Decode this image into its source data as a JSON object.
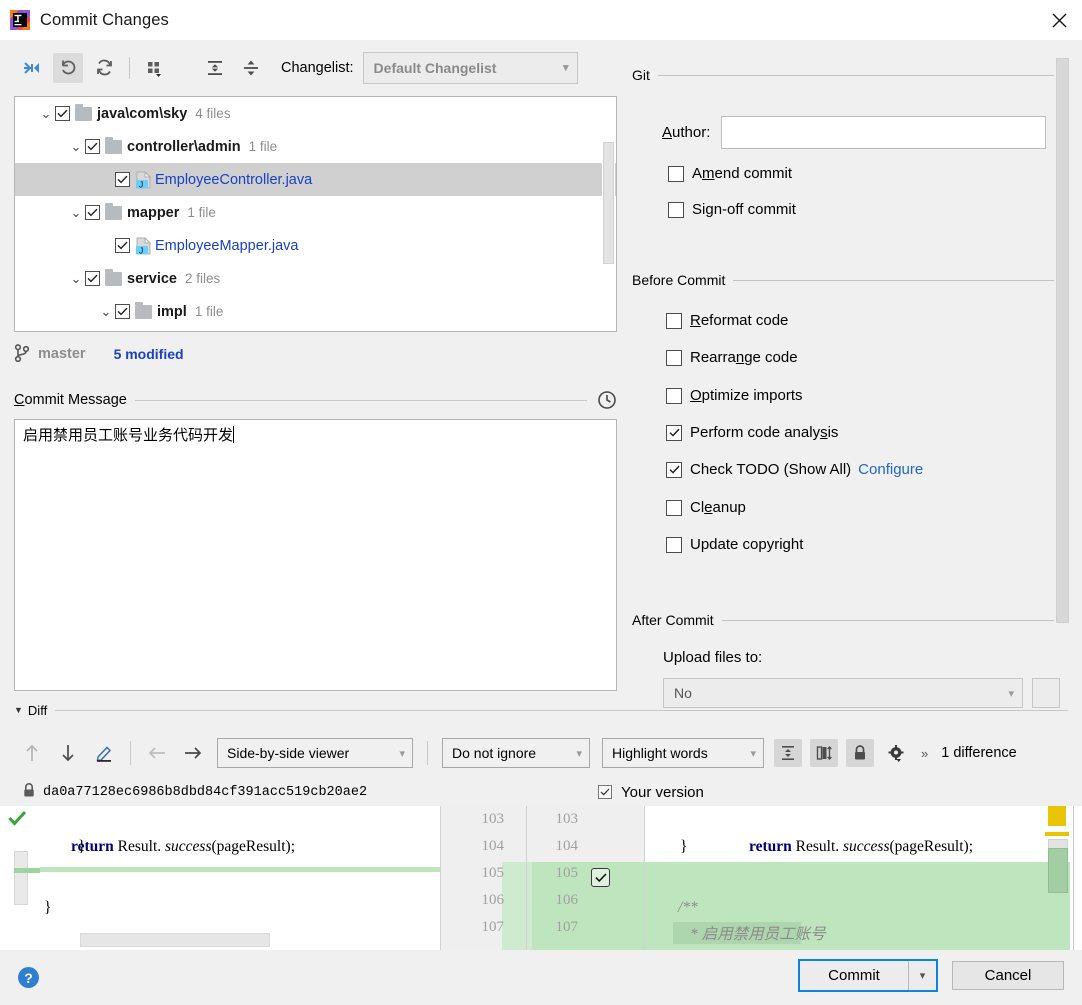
{
  "window": {
    "title": "Commit Changes",
    "logo_icon": "intellij-idea-logo",
    "close_icon": "close-icon"
  },
  "toolbar": {
    "icons": [
      {
        "name": "show-diff-icon",
        "glyph": "arrows-collapse"
      },
      {
        "name": "revert-icon",
        "glyph": "undo-arrow"
      },
      {
        "name": "refresh-icon",
        "glyph": "refresh-arrows"
      },
      {
        "name": "group-by-icon",
        "glyph": "grid-dropdown"
      },
      {
        "name": "expand-all-icon",
        "glyph": "expand"
      },
      {
        "name": "collapse-all-icon",
        "glyph": "collapse"
      }
    ],
    "changelist_label": "Changelist:",
    "changelist_value": "Default Changelist",
    "changelist_chevron": "chevron-down-icon"
  },
  "file_tree": {
    "rows": [
      {
        "indent": 0,
        "twisty": "⌄",
        "checked": true,
        "type": "folder",
        "name": "java\\com\\sky",
        "count": "4 files",
        "selected": false
      },
      {
        "indent": 1,
        "twisty": "⌄",
        "checked": true,
        "type": "folder",
        "name": "controller\\admin",
        "count": "1 file",
        "selected": false
      },
      {
        "indent": 2,
        "twisty": "",
        "checked": true,
        "type": "java",
        "name": "EmployeeController.java",
        "count": "",
        "selected": true
      },
      {
        "indent": 1,
        "twisty": "⌄",
        "checked": true,
        "type": "folder",
        "name": "mapper",
        "count": "1 file",
        "selected": false
      },
      {
        "indent": 2,
        "twisty": "",
        "checked": true,
        "type": "java",
        "name": "EmployeeMapper.java",
        "count": "",
        "selected": false
      },
      {
        "indent": 1,
        "twisty": "⌄",
        "checked": true,
        "type": "folder",
        "name": "service",
        "count": "2 files",
        "selected": false
      },
      {
        "indent": 2,
        "twisty": "⌄",
        "checked": true,
        "type": "folder",
        "name": "impl",
        "count": "1 file",
        "selected": false
      }
    ]
  },
  "branch_bar": {
    "icon": "git-branch-icon",
    "branch": "master",
    "modified": "5 modified"
  },
  "commit_message": {
    "section_label": "Commit Message",
    "history_icon": "clock-history-icon",
    "value": "启用禁用员工账号业务代码开发"
  },
  "right_panel": {
    "git_group": "Git",
    "author_label": "Author:",
    "author_value": "",
    "git_options": [
      {
        "label": "Amend commit",
        "checked": false,
        "mnemonic": "m"
      },
      {
        "label": "Sign-off commit",
        "checked": false,
        "mnemonic": "g"
      }
    ],
    "before_commit_group": "Before Commit",
    "before_commit_options": [
      {
        "label": "Reformat code",
        "checked": false,
        "mnemonic": "R"
      },
      {
        "label": "Rearrange code",
        "checked": false,
        "mnemonic": "n"
      },
      {
        "label": "Optimize imports",
        "checked": false,
        "mnemonic": "O"
      },
      {
        "label": "Perform code analysis",
        "checked": true,
        "mnemonic": "s"
      },
      {
        "label": "Check TODO (Show All)",
        "checked": true,
        "link": "Configure"
      },
      {
        "label": "Cleanup",
        "checked": false,
        "mnemonic": "e"
      },
      {
        "label": "Update copyright",
        "checked": false,
        "mnemonic": ""
      }
    ],
    "after_commit_group": "After Commit",
    "upload_label": "Upload files to:",
    "upload_value": "No",
    "upload_chevron": "chevron-down-icon"
  },
  "diff": {
    "section_label": "Diff",
    "collapse_icon": "triangle-down-icon",
    "nav_icons": [
      {
        "name": "previous-difference-icon",
        "glyph": "↑"
      },
      {
        "name": "next-difference-icon",
        "glyph": "↓"
      },
      {
        "name": "edit-source-icon",
        "glyph": "pencil"
      },
      {
        "name": "apply-left-icon",
        "glyph": "←"
      },
      {
        "name": "apply-right-icon",
        "glyph": "→"
      }
    ],
    "viewer_mode": "Side-by-side viewer",
    "ignore_mode": "Do not ignore",
    "highlight_mode": "Highlight words",
    "toggle_icons": [
      {
        "name": "collapse-unchanged-icon"
      },
      {
        "name": "synchronize-scrolling-icon"
      },
      {
        "name": "read-only-lock-icon"
      },
      {
        "name": "settings-gear-icon"
      }
    ],
    "more_icon": "chevron-double-right-icon",
    "difference_count": "1 difference",
    "left_version_lock_icon": "lock-icon",
    "left_version_label": "da0a77128ec6986b8dbd84cf391acc519cb20ae2",
    "right_version_checked": true,
    "right_version_label": "Your version",
    "accept_change_icon": "accept-change-checkbox",
    "left_lines": [
      {
        "num": "103",
        "text": "        return Result. success(pageResult);",
        "style": "code"
      },
      {
        "num": "104",
        "text": "    }",
        "style": "code"
      },
      {
        "num": "105",
        "text": "",
        "style": "blank"
      },
      {
        "num": "106",
        "text": "}",
        "style": "code"
      },
      {
        "num": "107",
        "text": "",
        "style": "blank"
      }
    ],
    "right_lines": [
      {
        "num": "103",
        "text": "        return Result. success(pageResult);",
        "style": "code",
        "added": false
      },
      {
        "num": "104",
        "text": "    }",
        "style": "code",
        "added": false
      },
      {
        "num": "105",
        "text": "",
        "style": "blank",
        "added": true
      },
      {
        "num": "106",
        "text": "    /**",
        "style": "comment",
        "added": true
      },
      {
        "num": "107",
        "text": "     * 启用禁用员工账号",
        "style": "comment",
        "added": true
      }
    ],
    "code_tokens": {
      "keyword": "return",
      "class_name": "Result.",
      "method": "success",
      "arg": "(pageResult);"
    }
  },
  "footer": {
    "help_icon": "help-icon",
    "help_glyph": "?",
    "commit_label": "Commit",
    "commit_dropdown_icon": "chevron-down-icon",
    "cancel_label": "Cancel"
  },
  "colors": {
    "accent_blue": "#0a84e0",
    "link_blue": "#2066c9",
    "file_link": "#1a41c4",
    "added_green": "#bfe5bf",
    "marker_yellow": "#e8c500",
    "dialog_bg": "#f0f0f0"
  }
}
